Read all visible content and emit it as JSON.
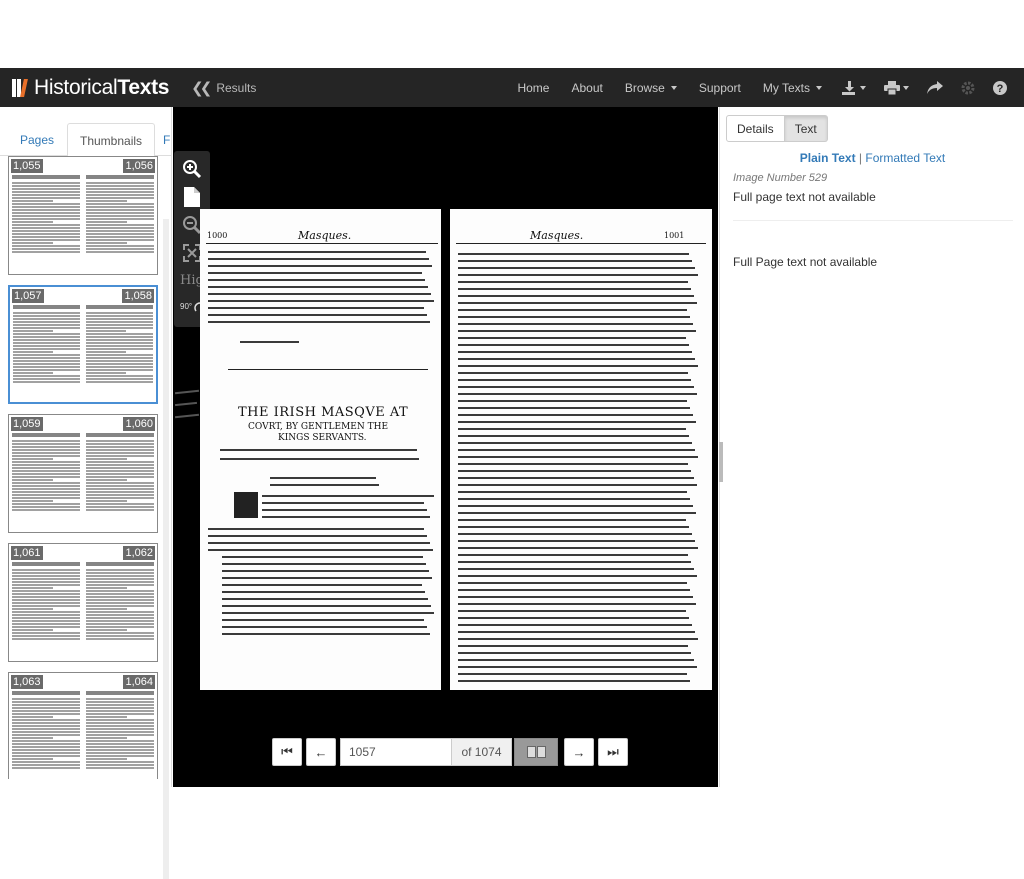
{
  "navbar": {
    "brand_light": "Historical",
    "brand_bold": "Texts",
    "back_label": "Results",
    "links": [
      {
        "label": "Home"
      },
      {
        "label": "About"
      },
      {
        "label": "Browse"
      },
      {
        "label": "Support"
      },
      {
        "label": "My Texts"
      }
    ],
    "icons": [
      "download-icon",
      "print-icon",
      "share-icon",
      "settings-icon",
      "help-icon"
    ]
  },
  "left_panel": {
    "tabs": [
      "Pages",
      "Thumbnails",
      "F"
    ],
    "active_tab": "Thumbnails",
    "thumbnails": [
      {
        "left": "1,055",
        "right": "1,056"
      },
      {
        "left": "1,057",
        "right": "1,058"
      },
      {
        "left": "1,059",
        "right": "1,060"
      },
      {
        "left": "1,061",
        "right": "1,062"
      },
      {
        "left": "1,063",
        "right": "1,064"
      }
    ],
    "selected_index": 1
  },
  "viewer": {
    "tools": [
      "zoom-in-icon",
      "page-icon",
      "zoom-out-icon",
      "fit-screen-icon"
    ],
    "highlight_label": "Hig",
    "rotate_label": "90°",
    "left_page": {
      "number": "1000",
      "heading": "Masques.",
      "title": "THE IRISH MASQVE AT",
      "subtitle1": "COVRT, BY GENTLEMEN THE",
      "subtitle2": "KINGS SERVANTS."
    },
    "right_page": {
      "number": "1001",
      "heading": "Masques."
    },
    "page_input": "1057",
    "page_total": "of 1074"
  },
  "right_panel": {
    "tabs": [
      "Details",
      "Text"
    ],
    "active_tab": "Text",
    "format_plain": "Plain Text",
    "format_sep": "|",
    "format_formatted": "Formatted Text",
    "image_number": "Image Number 529",
    "not_available_1": "Full page text not available",
    "not_available_2": "Full Page text not available"
  }
}
